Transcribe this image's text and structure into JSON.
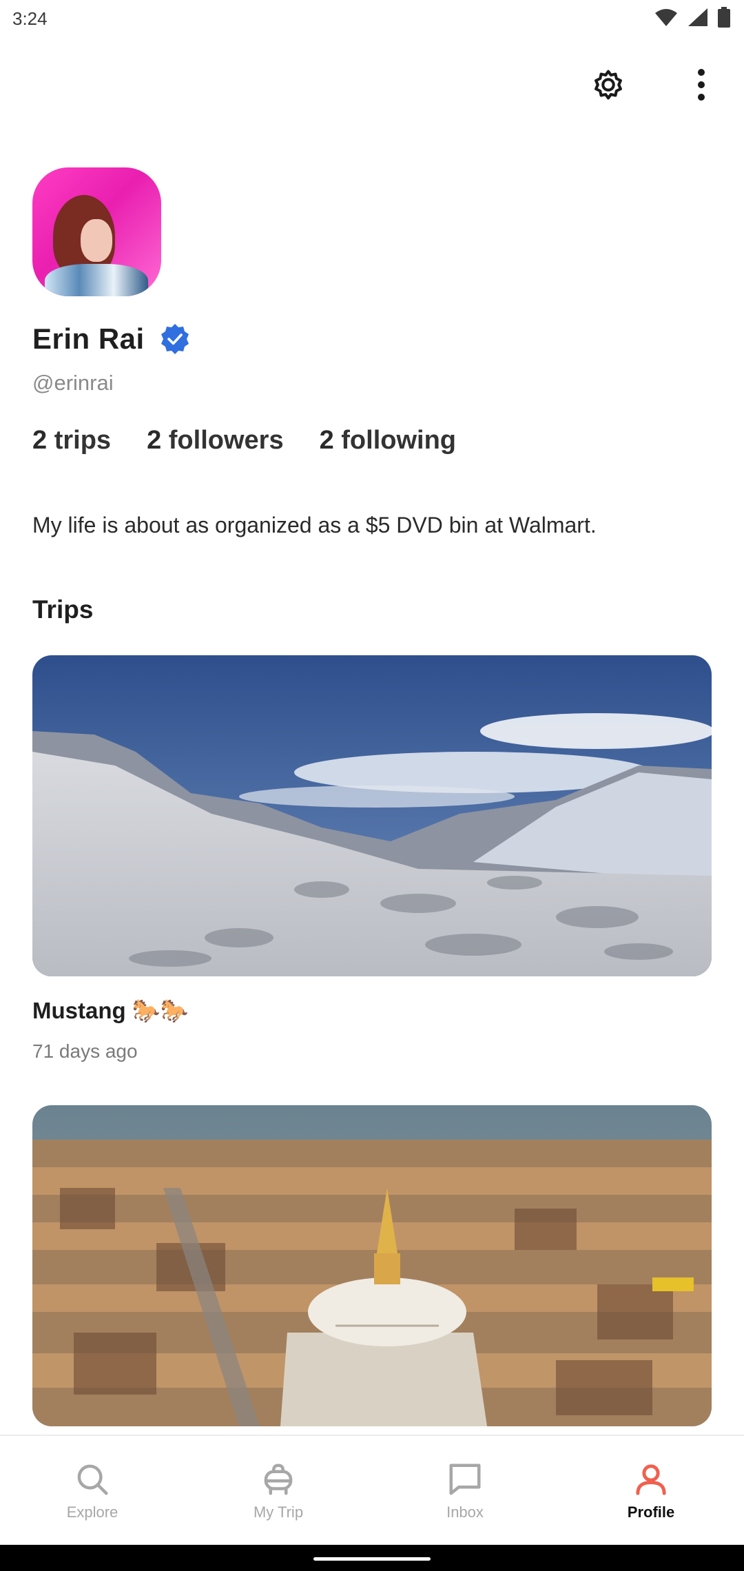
{
  "status_bar": {
    "time": "3:24",
    "icons": [
      "wifi-icon",
      "signal-icon",
      "battery-icon"
    ]
  },
  "top_actions": {
    "icons": [
      "gear-icon",
      "more-vertical-icon"
    ]
  },
  "profile": {
    "name": "Erin Rai",
    "handle": "@erinrai",
    "verified": true,
    "stats": {
      "trips_count": "2",
      "trips_label": "trips",
      "followers_count": "2",
      "followers_label": "followers",
      "following_count": "2",
      "following_label": "following"
    },
    "bio": "My life is about as organized as a $5 DVD bin at Walmart."
  },
  "trips_section": {
    "title": "Trips",
    "items": [
      {
        "title": "Mustang 🐎🐎",
        "date": "71 days ago"
      },
      {
        "title": "",
        "date": ""
      }
    ]
  },
  "bottom_nav": {
    "items": [
      {
        "label": "Explore",
        "icon": "search-icon",
        "active": false
      },
      {
        "label": "My Trip",
        "icon": "luggage-icon",
        "active": false
      },
      {
        "label": "Inbox",
        "icon": "chat-icon",
        "active": false
      },
      {
        "label": "Profile",
        "icon": "person-icon",
        "active": true
      }
    ]
  },
  "colors": {
    "accent": "#f0604f",
    "verified": "#2f6fe0",
    "text": "#1f1f1f",
    "muted": "#8a8a8a"
  }
}
